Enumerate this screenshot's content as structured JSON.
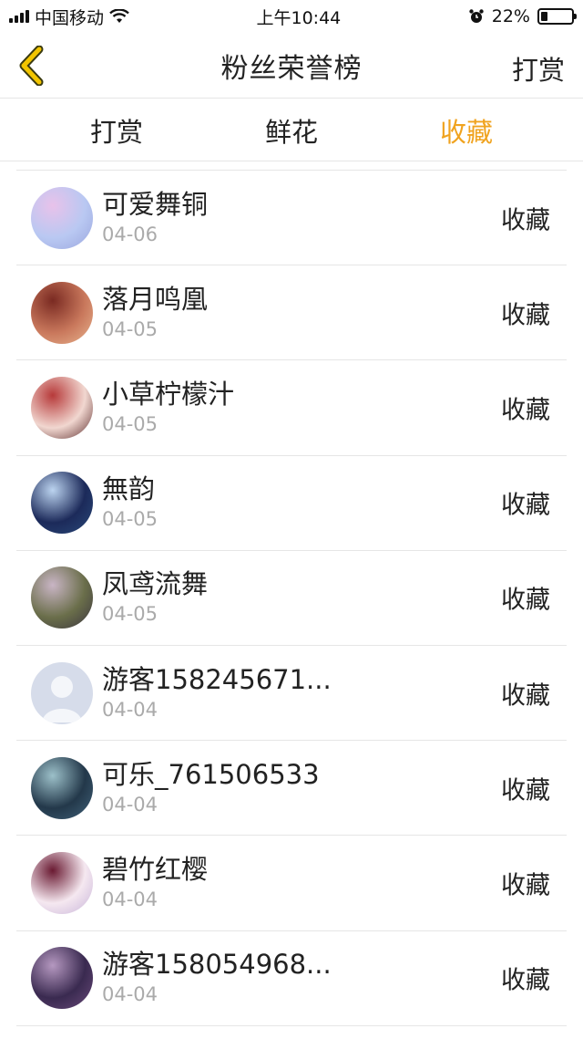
{
  "status": {
    "carrier": "中国移动",
    "time": "上午10:44",
    "battery": "22%",
    "battery_level": 0.22
  },
  "nav": {
    "title": "粉丝荣誉榜",
    "right": "打赏"
  },
  "tabs": [
    {
      "label": "打赏",
      "active": false
    },
    {
      "label": "鲜花",
      "active": false
    },
    {
      "label": "收藏",
      "active": true
    }
  ],
  "colors": {
    "accent": "#f0a31f",
    "back_icon": "#f2c500"
  },
  "rows": [
    {
      "name": "可爱舞铜",
      "date": "04-06",
      "action": "收藏",
      "avatar": [
        "#b9c8f2",
        "#e8c2ea",
        "#9aa6de"
      ]
    },
    {
      "name": "落月鸣凰",
      "date": "04-05",
      "action": "收藏",
      "avatar": [
        "#c9785c",
        "#7a2a22",
        "#e8b58f"
      ]
    },
    {
      "name": "小草柠檬汁",
      "date": "04-05",
      "action": "收藏",
      "avatar": [
        "#f1d7d0",
        "#b73a3a",
        "#5a2a2a"
      ]
    },
    {
      "name": "無韵",
      "date": "04-05",
      "action": "收藏",
      "avatar": [
        "#1c2a5a",
        "#bcd4f0",
        "#2a4a7a"
      ]
    },
    {
      "name": "凤鸢流舞",
      "date": "04-05",
      "action": "收藏",
      "avatar": [
        "#6a6e4a",
        "#c9b5c5",
        "#3a3440"
      ]
    },
    {
      "name": "游客158245671...",
      "date": "04-04",
      "action": "收藏",
      "avatar": [
        "#d6dcea",
        "#c3cadd",
        "#e4e8f2"
      ]
    },
    {
      "name": "可乐_761506533",
      "date": "04-04",
      "action": "收藏",
      "avatar": [
        "#23384a",
        "#9cc0c9",
        "#41627a"
      ]
    },
    {
      "name": "碧竹红樱",
      "date": "04-04",
      "action": "收藏",
      "avatar": [
        "#f5e8f0",
        "#6a1a32",
        "#c6b2d8"
      ]
    },
    {
      "name": "游客158054968...",
      "date": "04-04",
      "action": "收藏",
      "avatar": [
        "#3a2a50",
        "#b598c0",
        "#6a4a7a"
      ]
    }
  ]
}
